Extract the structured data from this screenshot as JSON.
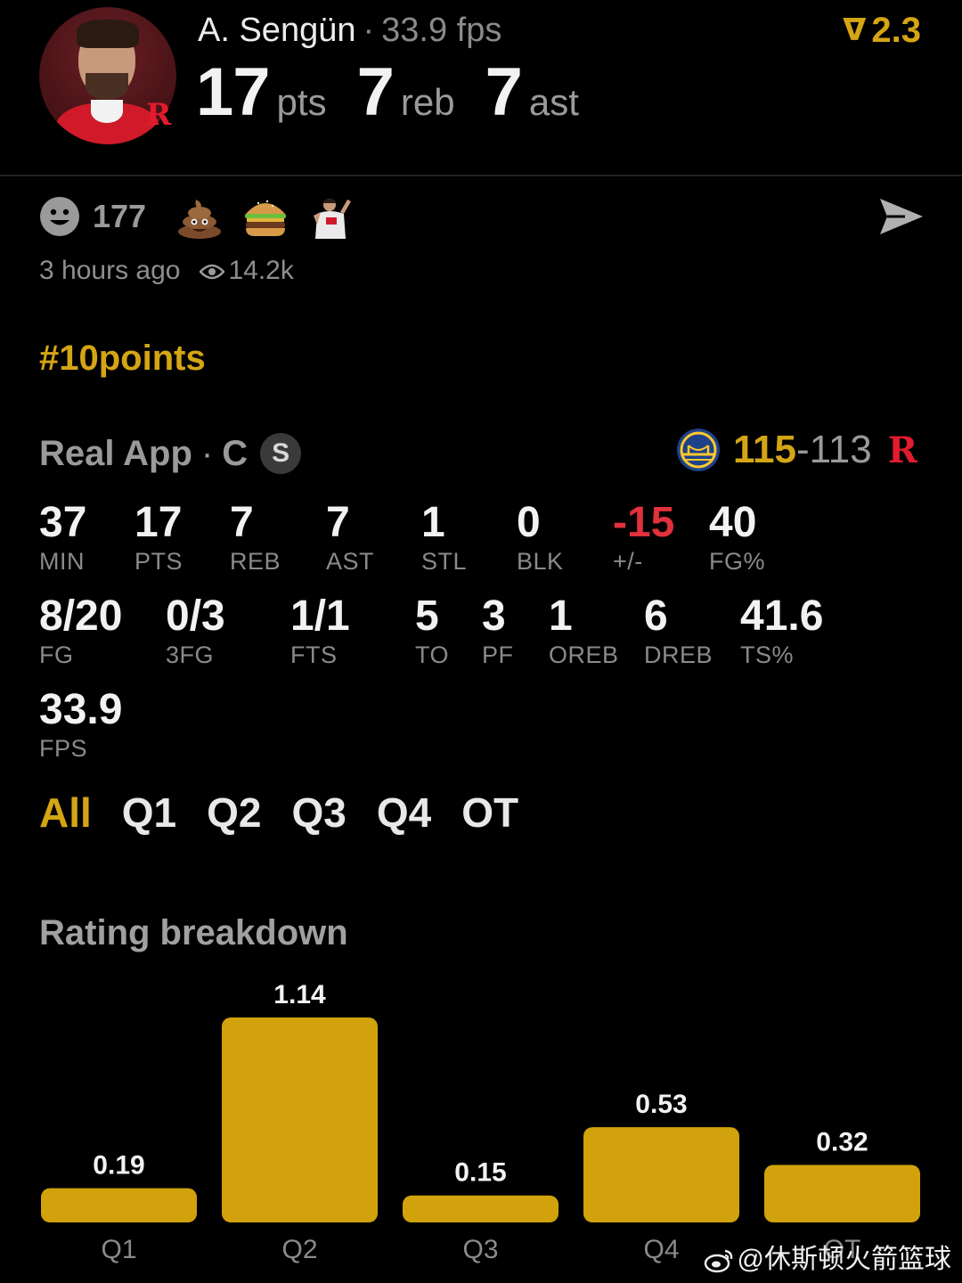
{
  "header": {
    "player_name": "A. Sengün",
    "separator": "·",
    "fps_text": "33.9 fps",
    "rating_value": "2.3",
    "rating_chevron": "ᐁ",
    "rockets_glyph": "R",
    "stats": [
      {
        "value": "17",
        "unit": "pts"
      },
      {
        "value": "7",
        "unit": "reb"
      },
      {
        "value": "7",
        "unit": "ast"
      }
    ]
  },
  "reactions": {
    "count": "177",
    "time_ago": "3 hours ago",
    "views": "14.2k"
  },
  "hashtag": "#10points",
  "game": {
    "source": "Real App",
    "separator": "·",
    "position": "C",
    "starter_badge": "S",
    "home_score": "115",
    "dash": "-",
    "away_score": "113",
    "rockets_glyph": "R"
  },
  "box": {
    "row1": [
      {
        "value": "37",
        "label": "MIN"
      },
      {
        "value": "17",
        "label": "PTS"
      },
      {
        "value": "7",
        "label": "REB"
      },
      {
        "value": "7",
        "label": "AST"
      },
      {
        "value": "1",
        "label": "STL"
      },
      {
        "value": "0",
        "label": "BLK"
      },
      {
        "value": "-15",
        "label": "+/-"
      },
      {
        "value": "40",
        "label": "FG%"
      }
    ],
    "row2": [
      {
        "value": "8/20",
        "label": "FG"
      },
      {
        "value": "0/3",
        "label": "3FG"
      },
      {
        "value": "1/1",
        "label": "FTS"
      },
      {
        "value": "5",
        "label": "TO"
      },
      {
        "value": "3",
        "label": "PF"
      },
      {
        "value": "1",
        "label": "OREB"
      },
      {
        "value": "6",
        "label": "DREB"
      },
      {
        "value": "41.6",
        "label": "TS%"
      }
    ],
    "row3": [
      {
        "value": "33.9",
        "label": "FPS"
      }
    ]
  },
  "quarter_tabs": [
    "All",
    "Q1",
    "Q2",
    "Q3",
    "Q4",
    "OT"
  ],
  "active_tab": "All",
  "rating_title": "Rating breakdown",
  "chart_data": {
    "type": "bar",
    "categories": [
      "Q1",
      "Q2",
      "Q3",
      "Q4",
      "OT"
    ],
    "values": [
      0.19,
      1.14,
      0.15,
      0.53,
      0.32
    ],
    "value_labels": [
      "0.19",
      "1.14",
      "0.15",
      "0.53",
      "0.32"
    ],
    "title": "Rating breakdown",
    "xlabel": "",
    "ylabel": "",
    "ylim": [
      0,
      1.14
    ],
    "bar_color": "#d1a20c",
    "grid": false
  },
  "watermark": "@休斯顿火箭篮球",
  "colors": {
    "accent_gold": "#d4a514",
    "negative_red": "#e0313c",
    "rockets_red": "#e31b2e",
    "background": "#000000",
    "warriors_blue": "#1d428a",
    "warriors_gold": "#ffc72c"
  }
}
